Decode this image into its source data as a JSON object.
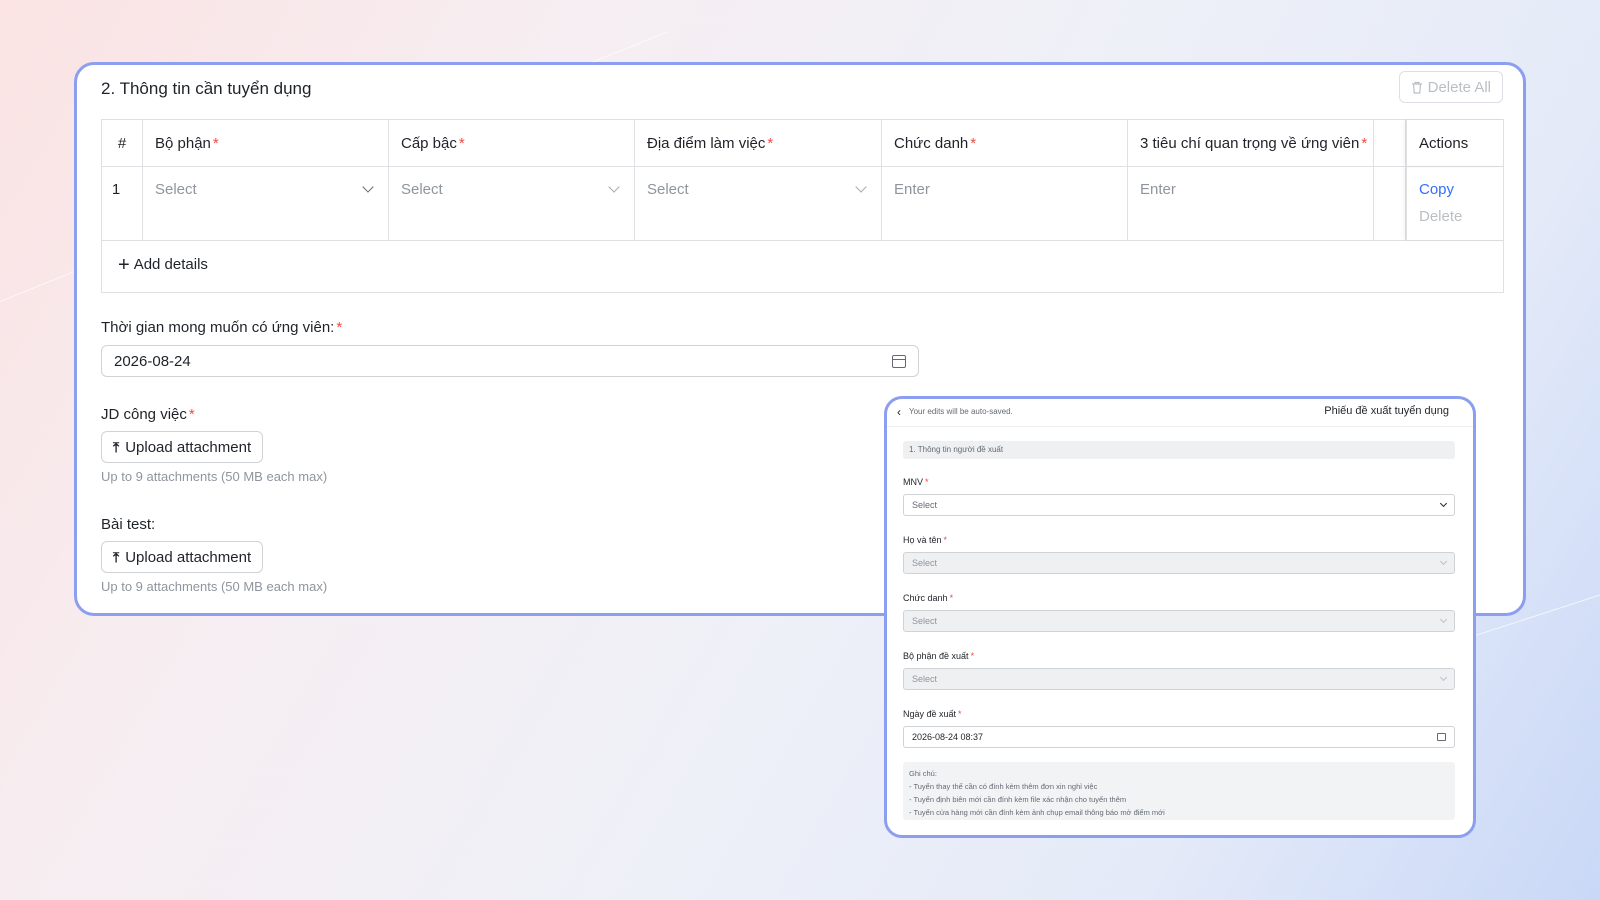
{
  "main": {
    "section_title": "2. Thông tin cần tuyển dụng",
    "delete_all_label": "Delete All",
    "table": {
      "headers": {
        "index": "#",
        "col1": "Bộ phận",
        "col2": "Cấp bậc",
        "col3": "Địa điểm làm việc",
        "col4": "Chức danh",
        "col5": "3 tiêu chí quan trọng về ứng viên",
        "actions": "Actions"
      },
      "required_mark": "*",
      "row": {
        "index": "1",
        "col1_placeholder": "Select",
        "col2_placeholder": "Select",
        "col3_placeholder": "Select",
        "col4_placeholder": "Enter",
        "col5_placeholder": "Enter",
        "copy_label": "Copy",
        "delete_label": "Delete"
      },
      "add_details_label": "Add details"
    },
    "desired_time": {
      "label": "Thời gian mong muốn có ứng viên:",
      "value": "2026-08-24"
    },
    "jd": {
      "label": "JD công việc",
      "upload_label": "Upload attachment",
      "hint": "Up to 9 attachments (50 MB each max)"
    },
    "test": {
      "label": "Bài test:",
      "upload_label": "Upload attachment",
      "hint": "Up to 9 attachments (50 MB each max)"
    }
  },
  "mobile": {
    "autosave_text": "Your edits will be auto-saved.",
    "title": "Phiếu đề xuất tuyển dụng",
    "section": "1. Thông tin người đề xuất",
    "fields": [
      {
        "label": "MNV",
        "value": "Select"
      },
      {
        "label": "Họ và tên",
        "value": "Select"
      },
      {
        "label": "Chức danh",
        "value": "Select"
      },
      {
        "label": "Bộ phận đề xuất",
        "value": "Select"
      },
      {
        "label": "Ngày đề xuất",
        "value": "2026-08-24 08:37"
      }
    ],
    "note": {
      "title": "Ghi chú:",
      "lines": [
        "- Tuyển thay thế cần có đính kèm thêm đơn xin nghỉ việc",
        "- Tuyển định biên mới cần đính kèm file xác nhận cho tuyển thêm",
        "- Tuyển cửa hàng mới cần đính kèm ảnh chụp email thông báo mở điểm mới"
      ]
    }
  }
}
